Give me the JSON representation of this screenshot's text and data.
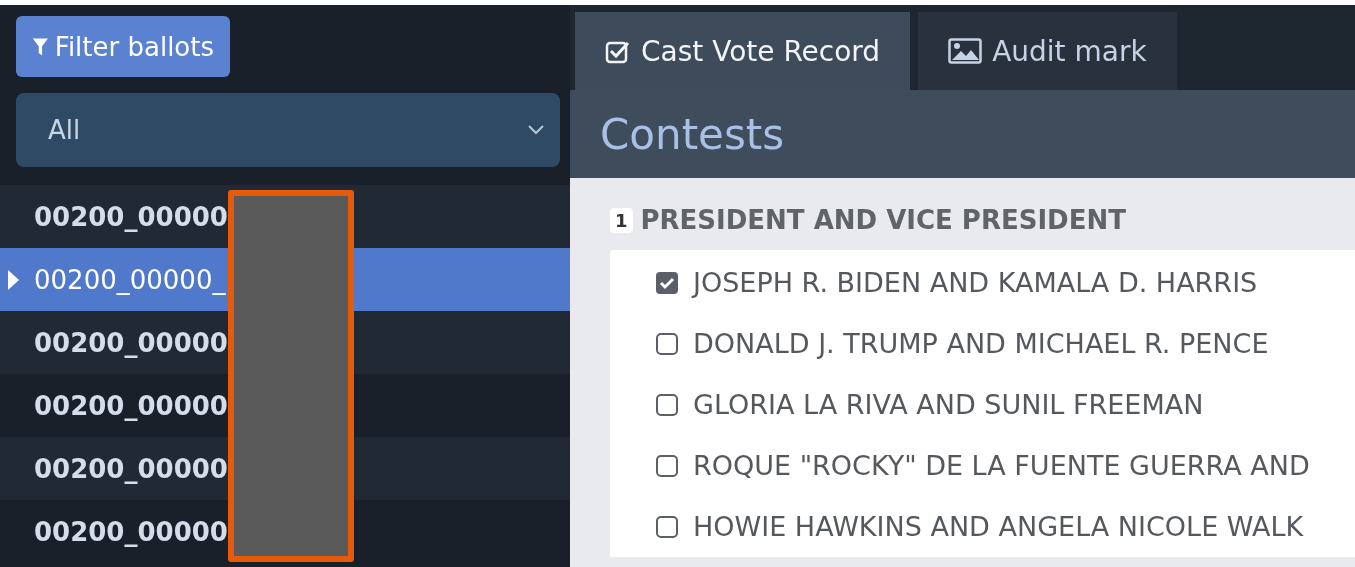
{
  "sidebar": {
    "filter_button": {
      "label": "Filter ballots"
    },
    "select": {
      "value": "All"
    },
    "ballots": [
      {
        "label": "00200_00000",
        "selected": false
      },
      {
        "label": "00200_00000_",
        "selected": true
      },
      {
        "label": "00200_00000",
        "selected": false
      },
      {
        "label": "00200_00000",
        "selected": false
      },
      {
        "label": "00200_00000",
        "selected": false
      },
      {
        "label": "00200_00000",
        "selected": false
      }
    ],
    "redaction": {
      "kind": "redaction"
    }
  },
  "tabs": [
    {
      "label": "Cast Vote Record",
      "selected": true
    },
    {
      "label": "Audit mark",
      "selected": false
    }
  ],
  "heading": "Contests",
  "contests": [
    {
      "number": "1",
      "title": "PRESIDENT AND VICE PRESIDENT",
      "candidates": [
        {
          "name": "JOSEPH R. BIDEN AND KAMALA D. HARRIS",
          "checked": true
        },
        {
          "name": "DONALD J. TRUMP AND MICHAEL R. PENCE",
          "checked": false
        },
        {
          "name": "GLORIA LA RIVA AND SUNIL FREEMAN",
          "checked": false
        },
        {
          "name": "ROQUE \"ROCKY\" DE LA FUENTE GUERRA AND",
          "checked": false
        },
        {
          "name": "HOWIE HAWKINS AND ANGELA NICOLE WALK",
          "checked": false
        }
      ]
    }
  ]
}
